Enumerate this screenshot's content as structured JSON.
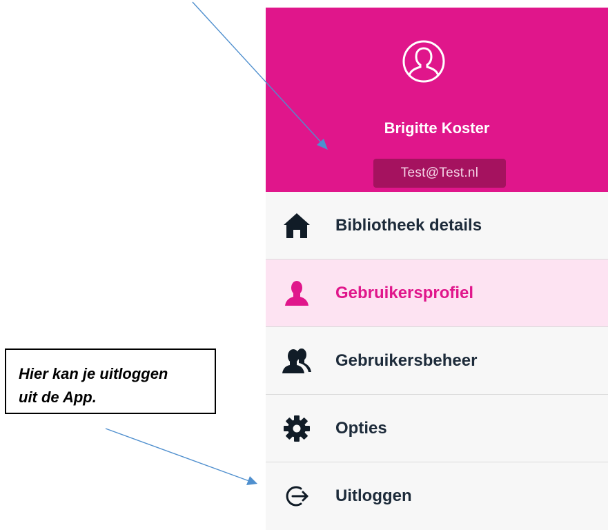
{
  "profile": {
    "name": "Brigitte Koster",
    "email": "Test@Test.nl",
    "avatar_icon": "user-circle-icon"
  },
  "menu": {
    "items": [
      {
        "label": "Bibliotheek details",
        "icon": "home-icon",
        "active": false
      },
      {
        "label": "Gebruikersprofiel",
        "icon": "user-icon",
        "active": true
      },
      {
        "label": "Gebruikersbeheer",
        "icon": "users-icon",
        "active": false
      },
      {
        "label": "Opties",
        "icon": "gear-icon",
        "active": false
      },
      {
        "label": "Uitloggen",
        "icon": "logout-icon",
        "active": false
      }
    ]
  },
  "annotation": {
    "callout_line1": "Hier kan je uitloggen",
    "callout_line2": "uit de App."
  },
  "colors": {
    "brand": "#e0168b",
    "active_background": "#fde3f2",
    "text": "#1d2b3a",
    "arrow": "#4f8fce"
  }
}
